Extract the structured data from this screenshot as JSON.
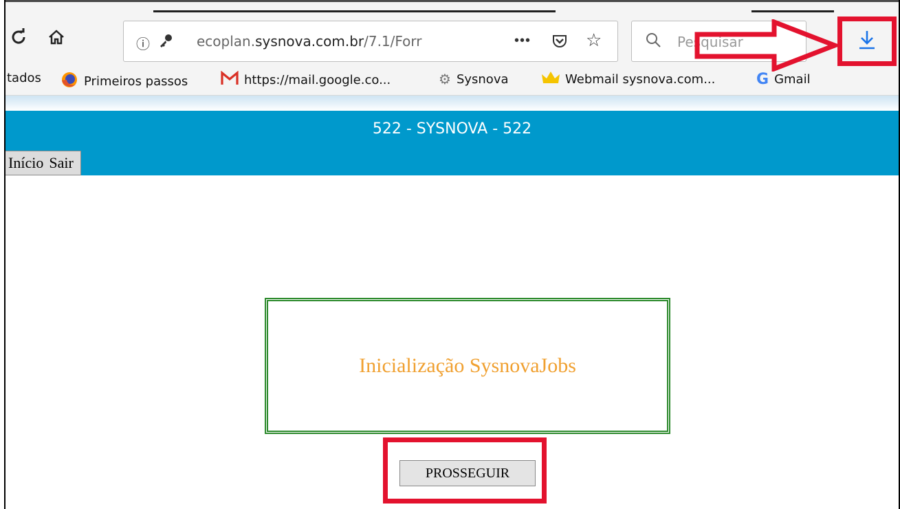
{
  "browser": {
    "url_host_prefix": "ecoplan.",
    "url_host_main": "sysnova.com.br",
    "url_path": "/7.1/Forr",
    "search_placeholder": "Pesquisar",
    "page_actions_label": "•••"
  },
  "bookmarks": [
    {
      "label": "tados",
      "icon": "none"
    },
    {
      "label": "Primeiros passos",
      "icon": "firefox-icon"
    },
    {
      "label": "https://mail.google.co...",
      "icon": "gmail-m-icon"
    },
    {
      "label": "Sysnova",
      "icon": "gear-icon"
    },
    {
      "label": "Webmail sysnova.com...",
      "icon": "crown-icon"
    },
    {
      "label": "Gmail",
      "icon": "google-g-icon"
    }
  ],
  "site": {
    "title": "522 - SYSNOVA - 522",
    "menu": [
      "Início",
      "Sair"
    ]
  },
  "main": {
    "card_text": "Inicialização SysnovaJobs",
    "button_label": "PROSSEGUIR"
  },
  "colors": {
    "header_bg": "#0099cc",
    "card_border": "#2e8b2e",
    "card_text": "#f0a030",
    "annotation_red": "#e3122e",
    "download_icon": "#1a73e8"
  }
}
